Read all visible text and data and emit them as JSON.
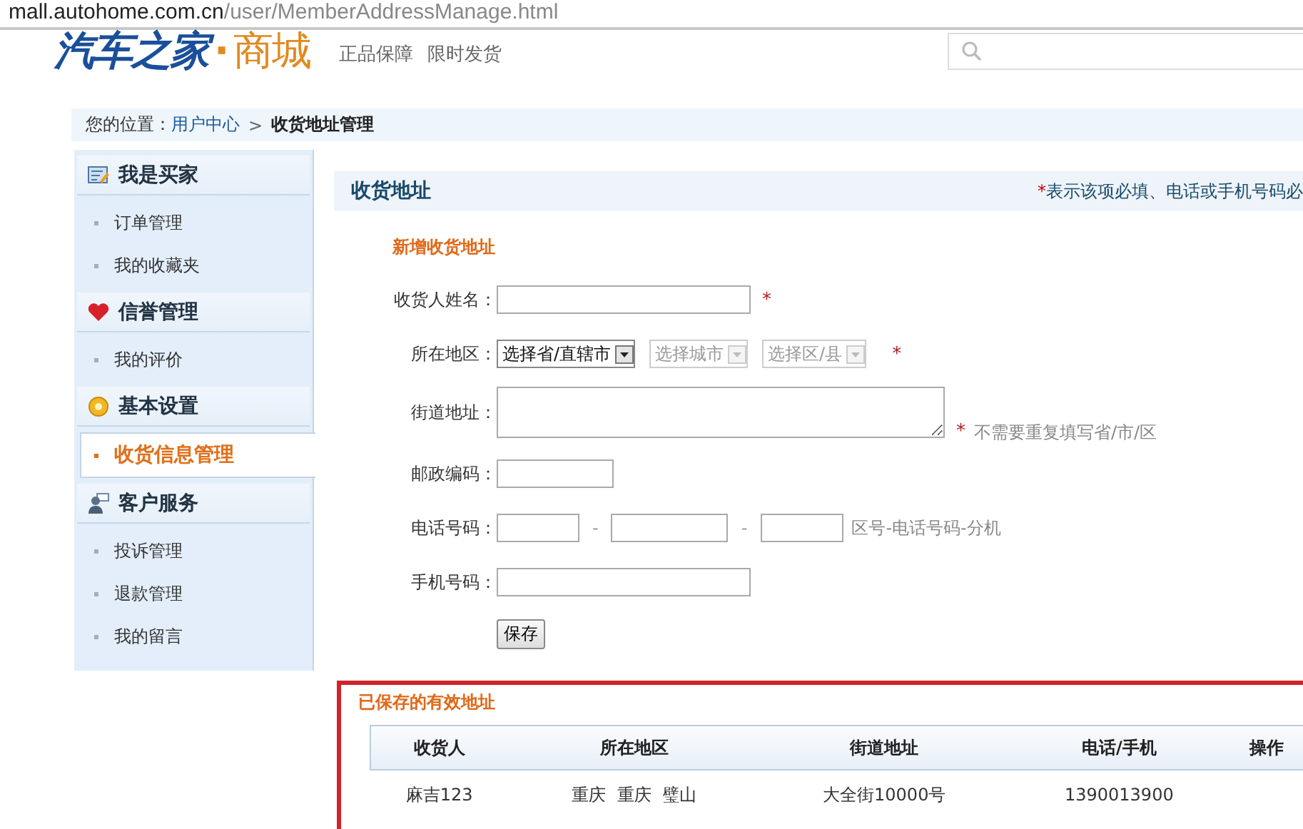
{
  "address_bar": {
    "host": "mall.autohome.com.cn",
    "path": "/user/MemberAddressManage.html"
  },
  "header": {
    "logo_main": "汽车之家",
    "logo_dot": "·",
    "logo_sub": "商城",
    "slogans": [
      "正品保障",
      "限时发货"
    ]
  },
  "breadcrumb": {
    "label": "您的位置：",
    "link": "用户中心",
    "separator": ">",
    "current": "收货地址管理"
  },
  "sidebar": {
    "sections": [
      {
        "title": "我是买家",
        "items": [
          {
            "label": "订单管理",
            "selected": false
          },
          {
            "label": "我的收藏夹",
            "selected": false
          }
        ]
      },
      {
        "title": "信誉管理",
        "items": [
          {
            "label": "我的评价",
            "selected": false
          }
        ]
      },
      {
        "title": "基本设置",
        "items": [
          {
            "label": "收货信息管理",
            "selected": true
          }
        ]
      },
      {
        "title": "客户服务",
        "items": [
          {
            "label": "投诉管理",
            "selected": false
          },
          {
            "label": "退款管理",
            "selected": false
          },
          {
            "label": "我的留言",
            "selected": false
          }
        ]
      }
    ]
  },
  "main": {
    "title": "收货地址",
    "note_mark": "*",
    "note": "表示该项必填、电话或手机号码必",
    "form_title": "新增收货地址",
    "required_mark": "*",
    "fields": [
      {
        "kind": "text",
        "label": "收货人姓名：",
        "required": true
      },
      {
        "kind": "region",
        "label": "所在地区：",
        "required": true,
        "selects": [
          {
            "value": "选择省/直辖市",
            "disabled": false
          },
          {
            "value": "选择城市",
            "disabled": true
          },
          {
            "value": "选择区/县",
            "disabled": true
          }
        ]
      },
      {
        "kind": "textarea",
        "label": "街道地址：",
        "required": true,
        "hint": "不需要重复填写省/市/区"
      },
      {
        "kind": "short",
        "label": "邮政编码：",
        "required": false
      },
      {
        "kind": "phone",
        "label": "电话号码：",
        "required": false,
        "separators": [
          "-",
          "-"
        ],
        "hint": "区号-电话号码-分机"
      },
      {
        "kind": "text",
        "label": "手机号码：",
        "required": false
      }
    ],
    "save_button": "保存"
  },
  "saved": {
    "title": "已保存的有效地址",
    "columns": [
      "收货人",
      "所在地区",
      "街道地址",
      "电话/手机",
      "操作"
    ],
    "rows": [
      [
        "麻吉123",
        "重庆  重庆  璧山",
        "大全街10000号",
        "1390013900"
      ]
    ]
  }
}
